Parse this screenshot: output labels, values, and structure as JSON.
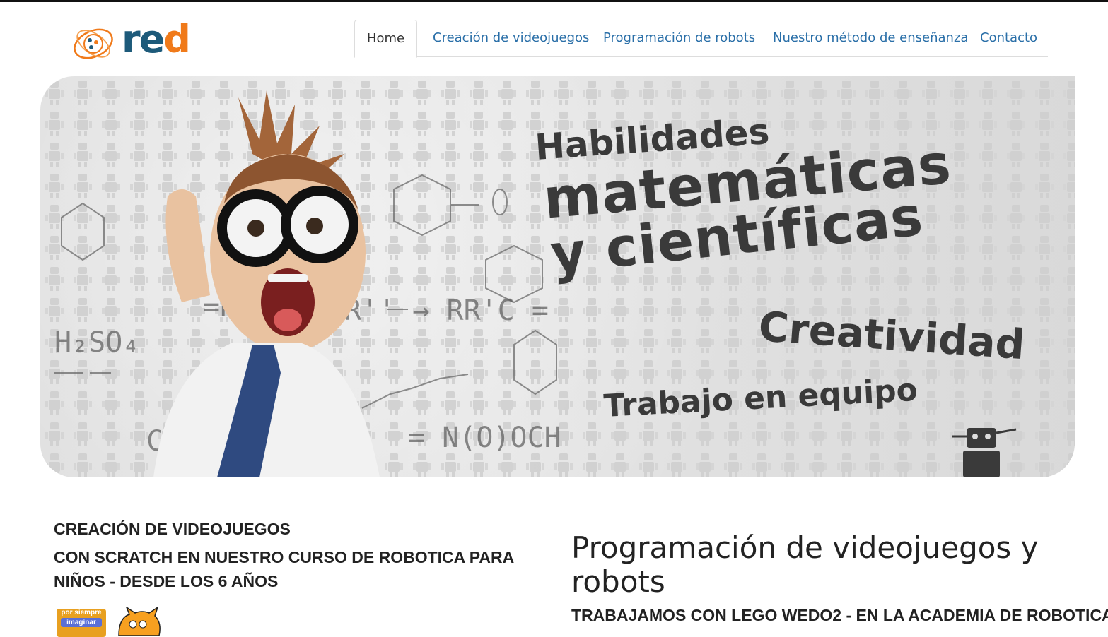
{
  "logo": {
    "text_main": "re",
    "text_accent": "d"
  },
  "nav": {
    "items": [
      {
        "label": "Home"
      },
      {
        "label": "Creación de videojuegos"
      },
      {
        "label": "Programación de robots"
      },
      {
        "label": "Nuestro método de enseñanza"
      },
      {
        "label": "Contacto"
      }
    ]
  },
  "hero": {
    "line1": "Habilidades",
    "line2": "matemáticas",
    "line3": "y científicas",
    "line4": "Creatividad",
    "line5": "Trabajo en equipo"
  },
  "left_section": {
    "heading": "CREACIÓN DE VIDEOJUEGOS",
    "subheading": "CON SCRATCH EN NUESTRO CURSO DE ROBOTICA PARA NIÑOS - DESDE LOS 6 AÑOS",
    "scratch_top": "por siempre",
    "scratch_bottom": "imaginar"
  },
  "right_section": {
    "heading": "Programación de videojuegos y robots",
    "subheading": "TRABAJAMOS CON LEGO WEDO2 - EN LA ACADEMIA DE ROBOTICA"
  },
  "colors": {
    "link": "#2a6fa8",
    "logo_blue": "#1d5a7a",
    "logo_orange": "#f07a1a"
  }
}
